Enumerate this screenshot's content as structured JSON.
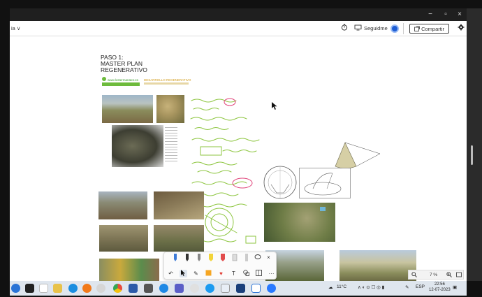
{
  "window": {
    "controls": {
      "minimize": "−",
      "maximize": "▫",
      "close": "×"
    }
  },
  "toolbar": {
    "left_label": "ia ∨",
    "follow_label": "Seguidme",
    "share_label": "Compartir"
  },
  "canvas": {
    "heading": [
      "PASO 1:",
      "MASTER PLAN",
      "REGENERATIVO"
    ],
    "logo_green": "www.lostermanator.es",
    "logo_orange": "DESARROLLO REGENERATIVO"
  },
  "notes": {
    "handwriting": [
      "∑V = 4000",
      "S = 4000+50",
      "= 63.25",
      "= 300 + 1000",
      "A = 1/2 (Lb·b)",
      "L = √(b²+h²)",
      "S = Σ h²",
      "x = 3",
      "r = A/√2"
    ],
    "ink_color": "#8ec641",
    "accent_color": "#e0457b"
  },
  "zoom": {
    "level": "7 %"
  },
  "taskbar": {
    "weather": "11°C",
    "lang": "ESP",
    "time": "22:56",
    "date": "12-07-2023"
  },
  "colors": {
    "accent_blue": "#1f5fd6",
    "logo_green": "#6dbb3c",
    "logo_orange": "#d19a18"
  }
}
